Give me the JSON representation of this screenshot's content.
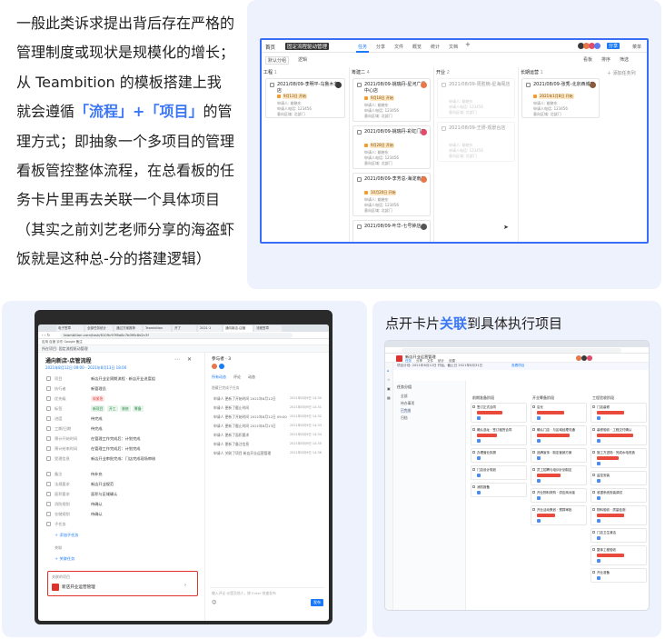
{
  "intro": {
    "pre": "一般此类诉求提出背后存在严格的管理制度或现状是规模化的增长；从 Teambition 的模板搭建上我就会遵循",
    "hl1": "「流程」",
    "plus": "+",
    "hl2": "「项目」",
    "post": "的管理方式；即抽象一个多项目的管理看板管控整体流程，在总看板的任务卡片里再去关联一个具体项目（其实之前刘艺老师分享的海盗虾饭就是这种总-分的搭建逻辑）"
  },
  "caption": {
    "pre": "点开卡片",
    "hl": "关联",
    "post": "到具体执行项目"
  },
  "kanban": {
    "home": "首页",
    "project_name": "固定流程驱动管理",
    "tabs": [
      "任务",
      "分享",
      "文件",
      "概览",
      "统计",
      "文档"
    ],
    "share": "分享",
    "menu": "菜单",
    "group_btn": "默认分组",
    "filter_btn": "逻辑",
    "view_btn": "看板",
    "sort_btn": "排序",
    "filter2": "筛选",
    "add_group": "添加任务列",
    "columns": [
      {
        "name": "工程",
        "count": "1"
      },
      {
        "name": "筹建二",
        "count": "4"
      },
      {
        "name": "开业",
        "count": "2"
      },
      {
        "name": "长期运营",
        "count": "1"
      }
    ],
    "cards": [
      {
        "title": "2021/08/09-李明平-乌鲁木齐店",
        "tag": "9月13日 开始",
        "meta1": "申请人: 姚晓东",
        "meta2": "申请人电话: 123456",
        "meta3": "意向区域: 北部门"
      },
      {
        "title": "2021/08/09-姚瑞丹-星河广场中心店",
        "tag": "9月18日 开始",
        "meta1": "申请人: 姚晓东",
        "meta2": "申请人电话: 123456",
        "meta3": "意向区域: 北部门"
      },
      {
        "title": "2021/08/09-姚瑞丹-彩虹门店",
        "tag": "9月28日 开始",
        "meta1": "申请人: 姚晓东",
        "meta2": "申请人电话: 123456",
        "meta3": "意向区域: 北部门"
      },
      {
        "title": "2021/08/09-李芳总-海淀南店",
        "tag": "10月20日 开始",
        "meta1": "申请人: 姚晓东",
        "meta2": "申请人电话: 123456",
        "meta3": "意向区域: 北部门"
      },
      {
        "title": "2021/08/09-叶华-七号钟店",
        "tag": "",
        "meta1": "",
        "meta2": "",
        "meta3": ""
      },
      {
        "title": "2021/08/09-周胜楠-星海阁店",
        "tag": "",
        "meta1": "申请人: 姚晓东",
        "meta2": "申请人电话: 123456",
        "meta3": "意向区域: 北部门"
      },
      {
        "title": "2021/08/09-王妍-观景台店",
        "tag": "",
        "meta1": "申请人: 姚晓东",
        "meta2": "申请人电话: 123456",
        "meta3": "意向区域: 北部门"
      },
      {
        "title": "2021/08/09-张秀-北京西城店",
        "tag": "2021年1月8日 开始",
        "meta1": "申请人: 姚晓东",
        "meta2": "申请人电话: 123456",
        "meta3": "意向区域: 北部门"
      }
    ],
    "colors": {
      "accent": "#1b7af6",
      "frame": "#3b6ef6",
      "tag": "#f59a2b"
    }
  },
  "detail": {
    "browser_tabs": [
      "电子签章",
      "全部任务统计",
      "通过方案推荐",
      "Teambition",
      "开了",
      "2021·1",
      "通向新店-店管",
      "流程签章"
    ],
    "url": "teambition.com/task/6109c97f8a8c7b0f6c8d2c3f",
    "bookmarks": "应用  百度  京东  Google  备注",
    "crumb": "所在项目: 固定流程驱动管理",
    "task_title": "通向新店-店管流程",
    "time_range": "2021年8月12日 09:00 - 2021年8月13日 18:00",
    "fields": [
      {
        "label": "项目",
        "value": "新店开业全周期流程 · 新店开业进度组"
      },
      {
        "label": "执行者",
        "value": "新管理员"
      },
      {
        "label": "优先级",
        "value": "较紧急"
      },
      {
        "label": "标签",
        "value": ""
      },
      {
        "label": "进度",
        "value": "待完成"
      },
      {
        "label": "工期/日期",
        "value": "待完成"
      },
      {
        "label": "预计开始时间",
        "value": "在管理工作完成后：计划完成"
      },
      {
        "label": "预计结束时间",
        "value": "在管理工作完成后：计划完成"
      },
      {
        "label": "受理信息",
        "value": "新店开业审批完成：门店完成现场审核"
      },
      {
        "label": "备注",
        "value": "待补充"
      },
      {
        "label": "法规要求",
        "value": "新店开业规范"
      },
      {
        "label": "面积要求",
        "value": "面积与区域确认"
      },
      {
        "label": "消防规划",
        "value": "待确认"
      },
      {
        "label": "仓储规划",
        "value": "待确认"
      },
      {
        "label": "子任务",
        "value": ""
      }
    ],
    "tags": [
      "新项目",
      "开工",
      "装修",
      "筹备"
    ],
    "add_subtask": "添加子任务",
    "link_label": "关联",
    "link_btn": "关联任务",
    "linked_project_header": "关联的项目",
    "linked_project": "新店开业运营管理",
    "participants_label": "参与者 · 3",
    "activity_tabs": [
      "所有动态",
      "评论",
      "动态"
    ],
    "activity_hide": "隐藏已完成子任务",
    "activities": [
      {
        "text": "申请人 更新了开始时间 2021年8月12日",
        "time": "2021年8月9日 14:30"
      },
      {
        "text": "申请人 更新了截止时间",
        "time": "2021年8月9日 14:31"
      },
      {
        "text": "申请人 更新了开始时间 2021年8月12日 09:00",
        "time": "2021年8月9日 14:32"
      },
      {
        "text": "申请人 更新了截止时间 2021年8月13日",
        "time": "2021年8月9日 14:33"
      },
      {
        "text": "申请人 更新了面积要求",
        "time": "2021年8月9日 14:34"
      },
      {
        "text": "申请人 更新了备注信息",
        "time": "2021年8月9日 14:35"
      },
      {
        "text": "申请人 关联了项目 新店开业运营管理",
        "time": "2021年8月9日 14:36"
      }
    ],
    "comment_placeholder": "输入评论 @提及他人，按 Enter 快速发布",
    "send": "发布",
    "colors": {
      "accent": "#1b7af6",
      "highlight": "#e0322d",
      "danger": "#e0322d"
    }
  },
  "board": {
    "project_name": "新店开业运营管理",
    "tabs": [
      "任务",
      "分享",
      "文件",
      "统计",
      "设置"
    ],
    "banner": "项目计划: 2021年8月12日 开始，截止日 2021年8月31日",
    "banner_link": "查看项目",
    "side_title": "任务分组",
    "side_items": [
      "全部",
      "待办事项",
      "已完成",
      "归档"
    ],
    "columns": [
      "前期准备阶段",
      "开业筹备阶段",
      "工程验收阶段"
    ],
    "col_cards": [
      [
        {
          "title": "签订正式合同",
          "red": 28
        },
        {
          "title": "确认选址 · 签订租赁合同",
          "red": 22
        },
        {
          "title": "办理营业执照",
          "red": 0
        },
        {
          "title": "门店设计规划",
          "red": 0
        },
        {
          "title": "消防报备",
          "red": 0
        }
      ],
      [
        {
          "title": "店长",
          "red": 30
        },
        {
          "title": "确认门店 · 与区域经理沟通",
          "red": 36
        },
        {
          "title": "品牌宣传 · 制定营销方案",
          "red": 0
        },
        {
          "title": "员工招聘与培训计划制定",
          "red": 26
        },
        {
          "title": "开业物料采购 · 供应商对接",
          "red": 0
        },
        {
          "title": "开业活动策划 · 预算审批",
          "red": 20
        }
      ],
      [
        {
          "title": "门店装修",
          "red": 30
        },
        {
          "title": "装修验收 · 工程交付确认",
          "red": 40
        },
        {
          "title": "施工方进场 · 完成水电改造",
          "red": 24
        },
        {
          "title": "监控安装",
          "red": 0
        },
        {
          "title": "收银系统安装调试",
          "red": 0
        },
        {
          "title": "物料验收 · 质量检测",
          "red": 30
        },
        {
          "title": "门店卫生清洁",
          "red": 0
        },
        {
          "title": "整体工程验收",
          "red": 30
        },
        {
          "title": "开业准备",
          "red": 0
        }
      ]
    ],
    "colors": {
      "accent": "#1b7af6",
      "red": "#ea4a3b"
    }
  }
}
